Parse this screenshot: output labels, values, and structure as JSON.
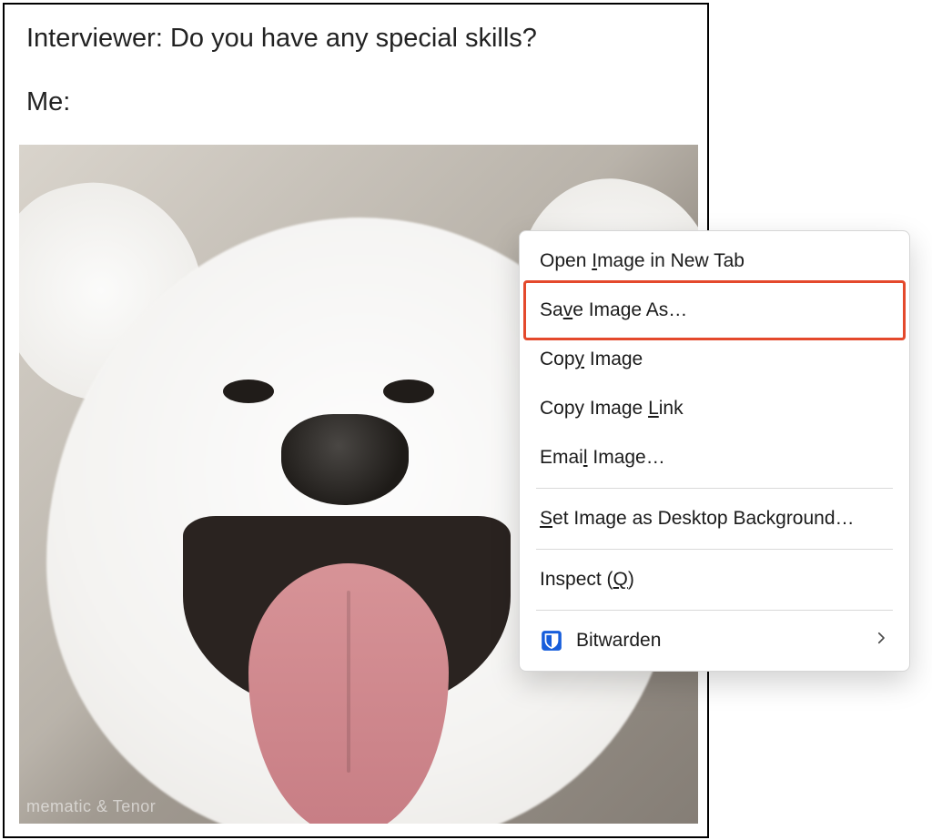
{
  "meme": {
    "line1": "Interviewer: Do you have any special skills?",
    "line2": "Me:",
    "watermark": "mematic & Tenor",
    "image_alt": "white fluffy dog with tongue out"
  },
  "context_menu": {
    "highlighted_index": 1,
    "items": [
      {
        "pre": "Open ",
        "key": "I",
        "post": "mage in New Tab",
        "has_divider_after": false
      },
      {
        "pre": "Sa",
        "key": "v",
        "post": "e Image As…",
        "has_divider_after": false
      },
      {
        "pre": "Cop",
        "key": "y",
        "post": " Image",
        "has_divider_after": false
      },
      {
        "pre": "Copy Image ",
        "key": "L",
        "post": "ink",
        "has_divider_after": false
      },
      {
        "pre": "Emai",
        "key": "l",
        "post": " Image…",
        "has_divider_after": true
      },
      {
        "pre": "",
        "key": "S",
        "post": "et Image as Desktop Background…",
        "has_divider_after": true
      },
      {
        "label": "Inspect (",
        "key": "Q",
        "label_after": ")",
        "has_divider_after": true
      }
    ],
    "extension": {
      "name": "Bitwarden",
      "icon": "bitwarden-shield-icon",
      "has_submenu": true
    },
    "highlight_color": "#e4492c"
  }
}
